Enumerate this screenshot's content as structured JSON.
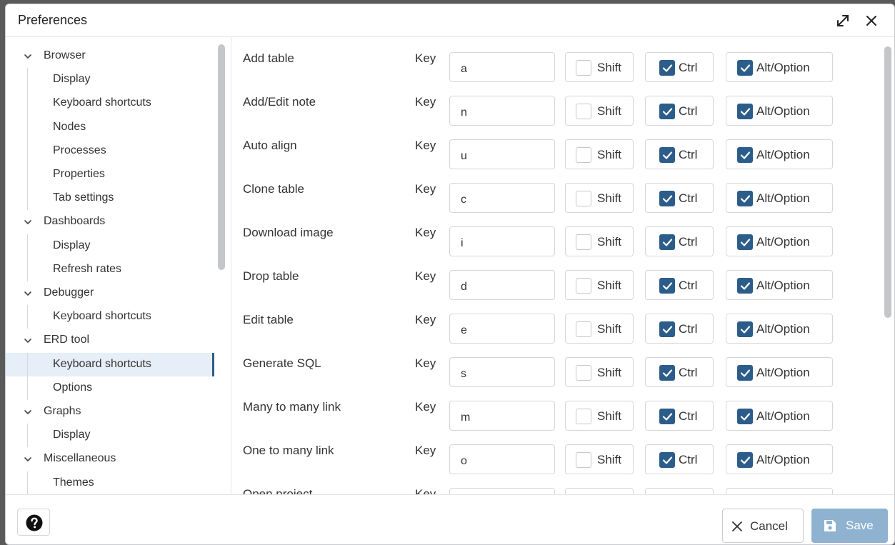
{
  "window": {
    "title": "Preferences"
  },
  "tree": {
    "groups": [
      {
        "label": "Browser",
        "children": [
          "Display",
          "Keyboard shortcuts",
          "Nodes",
          "Processes",
          "Properties",
          "Tab settings"
        ]
      },
      {
        "label": "Dashboards",
        "children": [
          "Display",
          "Refresh rates"
        ]
      },
      {
        "label": "Debugger",
        "children": [
          "Keyboard shortcuts"
        ]
      },
      {
        "label": "ERD tool",
        "children": [
          "Keyboard shortcuts",
          "Options"
        ]
      },
      {
        "label": "Graphs",
        "children": [
          "Display"
        ]
      },
      {
        "label": "Miscellaneous",
        "children": [
          "Themes"
        ]
      }
    ],
    "selected": "ERD tool / Keyboard shortcuts"
  },
  "shortcuts": {
    "key_label": "Key",
    "shift_label": "Shift",
    "ctrl_label": "Ctrl",
    "alt_label": "Alt/Option",
    "rows": [
      {
        "name": "Add table",
        "key": "a",
        "shift": false,
        "ctrl": true,
        "alt": true
      },
      {
        "name": "Add/Edit note",
        "key": "n",
        "shift": false,
        "ctrl": true,
        "alt": true
      },
      {
        "name": "Auto align",
        "key": "u",
        "shift": false,
        "ctrl": true,
        "alt": true
      },
      {
        "name": "Clone table",
        "key": "c",
        "shift": false,
        "ctrl": true,
        "alt": true
      },
      {
        "name": "Download image",
        "key": "i",
        "shift": false,
        "ctrl": true,
        "alt": true
      },
      {
        "name": "Drop table",
        "key": "d",
        "shift": false,
        "ctrl": true,
        "alt": true
      },
      {
        "name": "Edit table",
        "key": "e",
        "shift": false,
        "ctrl": true,
        "alt": true
      },
      {
        "name": "Generate SQL",
        "key": "s",
        "shift": false,
        "ctrl": true,
        "alt": true
      },
      {
        "name": "Many to many link",
        "key": "m",
        "shift": false,
        "ctrl": true,
        "alt": true
      },
      {
        "name": "One to many link",
        "key": "o",
        "shift": false,
        "ctrl": true,
        "alt": true
      },
      {
        "name": "Open project",
        "key": "",
        "shift": false,
        "ctrl": true,
        "alt": false
      }
    ]
  },
  "footer": {
    "cancel_label": "Cancel",
    "save_label": "Save"
  },
  "colors": {
    "accent": "#2c5d8a",
    "save_disabled": "#8fb2d1",
    "selected_row": "#e6eef8"
  },
  "icons": {
    "expand": "expand-arrows-icon",
    "close": "close-icon",
    "help": "help-icon",
    "cancel": "x-icon",
    "save": "floppy-disk-icon",
    "chevron": "chevron-down-icon"
  }
}
